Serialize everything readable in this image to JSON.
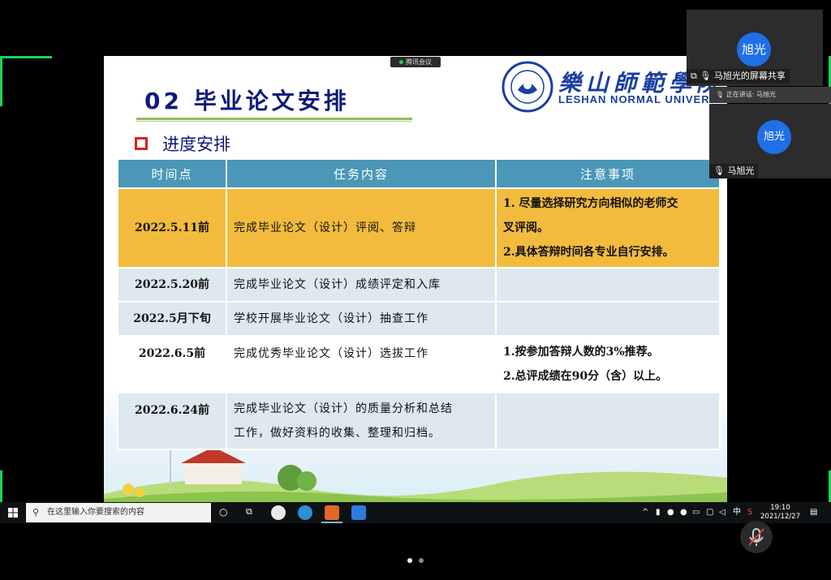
{
  "slide": {
    "title": "02  毕业论文安排",
    "school_cn": "樂山師範學院",
    "school_en": "LESHAN NORMAL UNIVERSITY",
    "section_title": "进度安排",
    "table": {
      "headers": [
        "时间点",
        "任务内容",
        "注意事项"
      ],
      "rows": [
        {
          "date": "2022.5.11前",
          "task": "完成毕业论文（设计）评阅、答辩",
          "notes": [
            "1. 尽量选择研究方向相似的老师交",
            "叉评阅。",
            "2.具体答辩时间各专业自行安排。"
          ]
        },
        {
          "date": "2022.5.20前",
          "task": "完成毕业论文（设计）成绩评定和入库",
          "notes": []
        },
        {
          "date": "2022.5月下旬",
          "task": "学校开展毕业论文（设计）抽查工作",
          "notes": []
        },
        {
          "date": "2022.6.5前",
          "task": "完成优秀毕业论文（设计）选拔工作",
          "notes": [
            "1.按参加答辩人数的3%推荐。",
            "2.总评成绩在90分（含）以上。"
          ]
        },
        {
          "date": "2022.6.24前",
          "task_lines": [
            "完成毕业论文（设计）的质量分析和总结",
            "工作，做好资料的收集、整理和归档。"
          ],
          "notes": []
        }
      ]
    }
  },
  "meeting": {
    "app_tag": "腾讯会议",
    "tile1_avatar": "旭光",
    "share_label": "马旭光的屏幕共享",
    "speaking_label": "正在讲话: 马旭光",
    "tile2_avatar": "旭光",
    "tile2_name": "马旭光"
  },
  "taskbar": {
    "search_placeholder": "在这里输入你要搜索的内容",
    "ime": "中",
    "time": "19:10",
    "date": "2021/12/27"
  },
  "colors": {
    "header_bg": "#4a97b8",
    "highlight_row": "#f2bb3d",
    "pale_row": "#dde8ef",
    "title_color": "#0d1a7a",
    "avatar_blue": "#1f6fe8",
    "share_green": "#1fd15a"
  }
}
